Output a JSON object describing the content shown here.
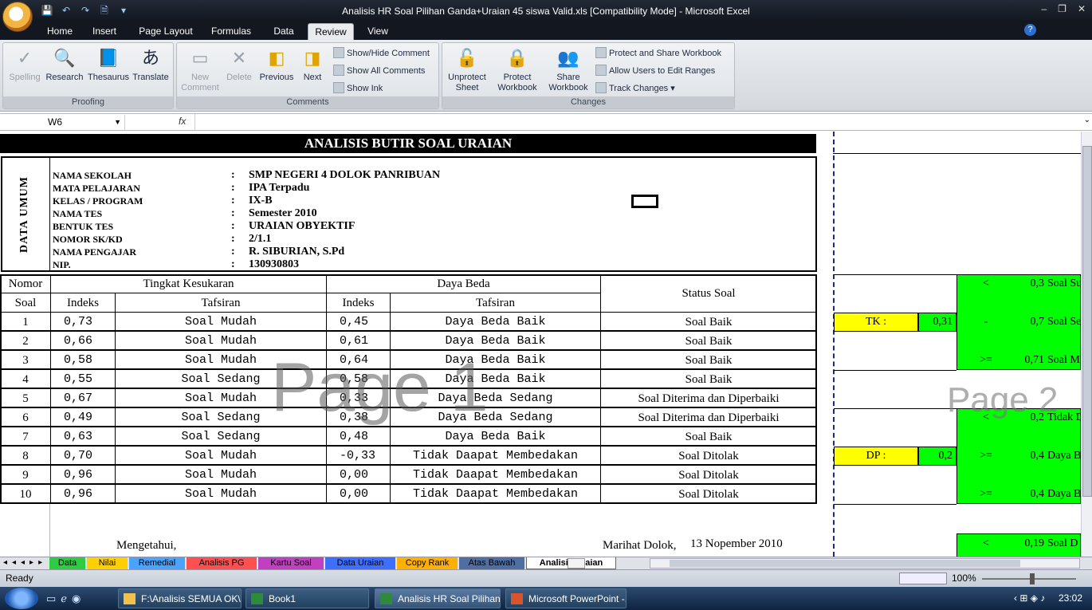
{
  "window": {
    "title": "Analisis HR Soal Pilihan Ganda+Uraian 45 siswa Valid.xls  [Compatibility Mode] - Microsoft Excel",
    "controls": [
      "–",
      "❐",
      "✕"
    ]
  },
  "qat": {
    "save_icon": "💾",
    "undo_icon": "↶",
    "redo_icon": "↷",
    "preview_icon": "🗎",
    "more_icon": "▾"
  },
  "tabs": [
    "Home",
    "Insert",
    "Page Layout",
    "Formulas",
    "Data",
    "Review",
    "View"
  ],
  "ribbon": {
    "proofing": {
      "label": "Proofing",
      "spelling": "Spelling",
      "research": "Research",
      "thesaurus": "Thesaurus",
      "translate": "Translate"
    },
    "comments": {
      "label": "Comments",
      "new_comment": "New Comment",
      "delete": "Delete",
      "previous": "Previous",
      "next": "Next",
      "show_hide": "Show/Hide Comment",
      "show_all": "Show All Comments",
      "show_ink": "Show Ink"
    },
    "changes": {
      "label": "Changes",
      "unprotect_sheet": "Unprotect Sheet",
      "protect_workbook": "Protect Workbook",
      "share_workbook": "Share Workbook",
      "protect_share": "Protect and Share Workbook",
      "allow_users": "Allow Users to Edit Ranges",
      "track_changes": "Track Changes"
    }
  },
  "formula": {
    "namebox": "W6",
    "fx": "fx",
    "value": ""
  },
  "sheet": {
    "title": "ANALISIS BUTIR SOAL URAIAN",
    "side_label": "DATA UMUM",
    "info": [
      {
        "key": "NAMA SEKOLAH",
        "sep": ":",
        "val": "SMP NEGERI 4 DOLOK PANRIBUAN"
      },
      {
        "key": "MATA PELAJARAN",
        "sep": ":",
        "val": "IPA Terpadu"
      },
      {
        "key": "KELAS / PROGRAM",
        "sep": ":",
        "val": "IX-B"
      },
      {
        "key": "NAMA TES",
        "sep": ":",
        "val": "Semester 2010"
      },
      {
        "key": "BENTUK TES",
        "sep": ":",
        "val": "URAIAN OBYEKTIF"
      },
      {
        "key": "NOMOR SK/KD",
        "sep": ":",
        "val": "2/1.1"
      },
      {
        "key": "NAMA PENGAJAR",
        "sep": ":",
        "val": "R. SIBURIAN, S.Pd"
      },
      {
        "key": "NIP.",
        "sep": ":",
        "val": "130930803"
      }
    ],
    "headers": {
      "nomor": "Nomor",
      "soal": "Soal",
      "tk": "Tingkat Kesukaran",
      "db": "Daya Beda",
      "indeks": "Indeks",
      "tafsiran": "Tafsiran",
      "status": "Status Soal"
    },
    "rows": [
      {
        "no": "1",
        "tk": "0,73",
        "tkt": "Soal Mudah",
        "db": "0,45",
        "dbt": "Daya Beda Baik",
        "status": "Soal Baik"
      },
      {
        "no": "2",
        "tk": "0,66",
        "tkt": "Soal Mudah",
        "db": "0,61",
        "dbt": "Daya Beda Baik",
        "status": "Soal Baik"
      },
      {
        "no": "3",
        "tk": "0,58",
        "tkt": "Soal Mudah",
        "db": "0,64",
        "dbt": "Daya Beda Baik",
        "status": "Soal Baik"
      },
      {
        "no": "4",
        "tk": "0,55",
        "tkt": "Soal Sedang",
        "db": "0,58",
        "dbt": "Daya Beda Baik",
        "status": "Soal Baik"
      },
      {
        "no": "5",
        "tk": "0,67",
        "tkt": "Soal Mudah",
        "db": "0,33",
        "dbt": "Daya Beda Sedang",
        "status": "Soal Diterima dan Diperbaiki"
      },
      {
        "no": "6",
        "tk": "0,49",
        "tkt": "Soal Sedang",
        "db": "0,38",
        "dbt": "Daya Beda Sedang",
        "status": "Soal Diterima dan Diperbaiki"
      },
      {
        "no": "7",
        "tk": "0,63",
        "tkt": "Soal Sedang",
        "db": "0,48",
        "dbt": "Daya Beda Baik",
        "status": "Soal Baik"
      },
      {
        "no": "8",
        "tk": "0,70",
        "tkt": "Soal Mudah",
        "db": "-0,33",
        "dbt": "Tidak Daapat Membedakan",
        "status": "Soal Ditolak"
      },
      {
        "no": "9",
        "tk": "0,96",
        "tkt": "Soal Mudah",
        "db": "0,00",
        "dbt": "Tidak Daapat Membedakan",
        "status": "Soal Ditolak"
      },
      {
        "no": "10",
        "tk": "0,96",
        "tkt": "Soal Mudah",
        "db": "0,00",
        "dbt": "Tidak Daapat Membedakan",
        "status": "Soal Ditolak"
      }
    ],
    "footer": {
      "mengetahui": "Mengetahui,",
      "place": "Marihat Dolok,",
      "date": "13 Nopember 2010"
    },
    "watermark1": "Page 1",
    "watermark2": "Page 2",
    "side": {
      "tk_label": "TK :",
      "tk_val": "0,31",
      "dp_label": "DP :",
      "dp_val": "0,2",
      "g1": [
        {
          "op": "<",
          "v": "0,3",
          "t": "Soal Su"
        },
        {
          "op": "-",
          "v": "0,7",
          "t": "Soal Se"
        },
        {
          "op": ">=",
          "v": "0,71",
          "t": "Soal M"
        }
      ],
      "g2": [
        {
          "op": "<",
          "v": "0,2",
          "t": "Tidak D"
        },
        {
          "op": ">=",
          "v": "0,4",
          "t": "Daya B"
        },
        {
          "op": ">=",
          "v": "0,4",
          "t": "Daya B"
        }
      ],
      "g3": {
        "op": "<",
        "v": "0,19",
        "t": "Soal D"
      },
      "colors": {
        "green": "#00ff00",
        "yellow": "#ffff00"
      }
    }
  },
  "sheet_tabs": [
    {
      "label": "Data",
      "color": "#2ecc40"
    },
    {
      "label": "Nilai",
      "color": "#ffd000"
    },
    {
      "label": "Remedial",
      "color": "#4aa3ff"
    },
    {
      "label": "Analisis PG",
      "color": "#ff5050"
    },
    {
      "label": "Kartu Soal",
      "color": "#c040c0"
    },
    {
      "label": "Data Uraian",
      "color": "#3d6fff"
    },
    {
      "label": "Copy Rank",
      "color": "#ffb000"
    },
    {
      "label": "Atas Bawah",
      "color": "#4f6fa0"
    },
    {
      "label": "Analisis Uraian",
      "color": "#ffffff"
    }
  ],
  "status": {
    "ready": "Ready",
    "zoom": "100%"
  },
  "taskbar": {
    "items": [
      "F:\\Analisis SEMUA OK\\...",
      "Book1",
      "Analisis HR Soal Pilihan ...",
      "Microsoft PowerPoint -..."
    ],
    "time": "23:02"
  }
}
